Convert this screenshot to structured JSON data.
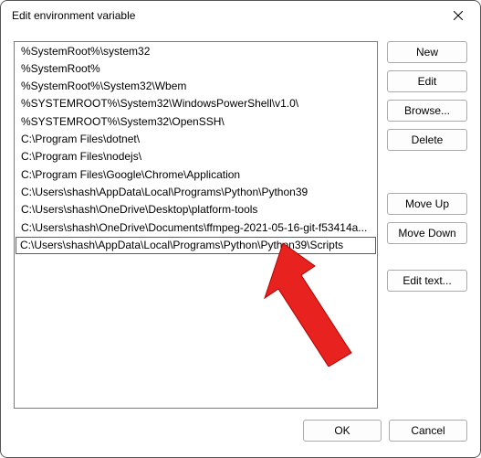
{
  "window": {
    "title": "Edit environment variable"
  },
  "paths": [
    "%SystemRoot%\\system32",
    "%SystemRoot%",
    "%SystemRoot%\\System32\\Wbem",
    "%SYSTEMROOT%\\System32\\WindowsPowerShell\\v1.0\\",
    "%SYSTEMROOT%\\System32\\OpenSSH\\",
    "C:\\Program Files\\dotnet\\",
    "C:\\Program Files\\nodejs\\",
    "C:\\Program Files\\Google\\Chrome\\Application",
    "C:\\Users\\shash\\AppData\\Local\\Programs\\Python\\Python39",
    "C:\\Users\\shash\\OneDrive\\Desktop\\platform-tools",
    "C:\\Users\\shash\\OneDrive\\Documents\\ffmpeg-2021-05-16-git-f53414a..."
  ],
  "editing": {
    "value": "C:\\Users\\shash\\AppData\\Local\\Programs\\Python\\Python39\\Scripts"
  },
  "buttons": {
    "new": "New",
    "edit": "Edit",
    "browse": "Browse...",
    "delete": "Delete",
    "moveUp": "Move Up",
    "moveDown": "Move Down",
    "editText": "Edit text...",
    "ok": "OK",
    "cancel": "Cancel"
  }
}
